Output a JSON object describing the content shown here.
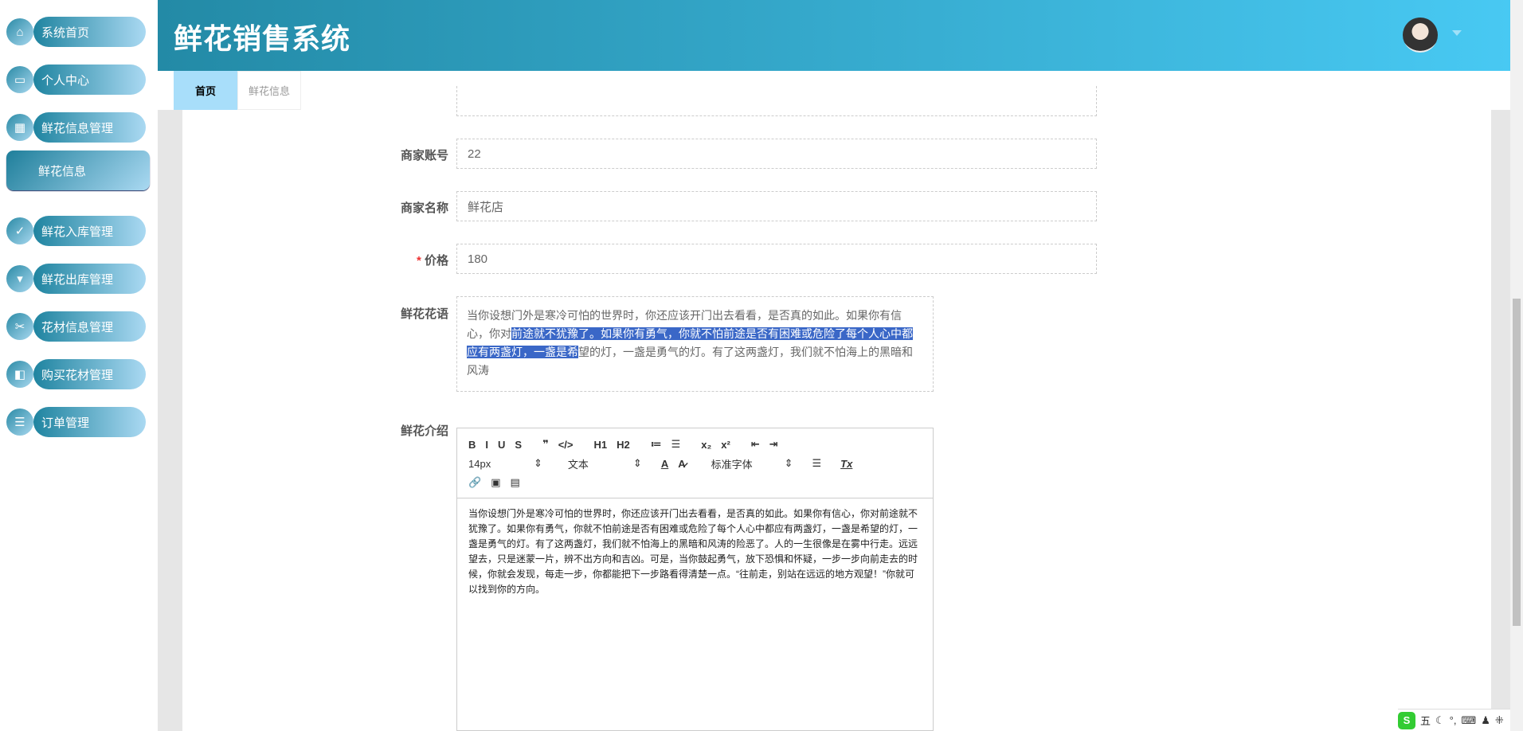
{
  "app": {
    "title": "鲜花销售系统"
  },
  "sidebar": {
    "items": [
      {
        "label": "系统首页",
        "icon": "home-icon"
      },
      {
        "label": "个人中心",
        "icon": "card-icon"
      },
      {
        "label": "鲜花信息管理",
        "icon": "grid-icon"
      },
      {
        "label": "鲜花入库管理",
        "icon": "clipboard-icon"
      },
      {
        "label": "鲜花出库管理",
        "icon": "brush-icon"
      },
      {
        "label": "花材信息管理",
        "icon": "ticket-icon"
      },
      {
        "label": "购买花材管理",
        "icon": "wallet-icon"
      },
      {
        "label": "订单管理",
        "icon": "list-icon"
      }
    ],
    "sub_item": "鲜花信息"
  },
  "tabs": [
    {
      "label": "首页"
    },
    {
      "label": "鲜花信息"
    }
  ],
  "form": {
    "merchant_account": {
      "label": "商家账号",
      "value": "22"
    },
    "merchant_name": {
      "label": "商家名称",
      "value": "鲜花店"
    },
    "price": {
      "required": "*",
      "label": "价格",
      "value": "180"
    },
    "flower_language": {
      "label": "鲜花花语",
      "before": "当你设想门外是寒冷可怕的世界时，你还应该开门出去看看，是否真的如此。如果你有信心，你对",
      "selected": "前途就不犹豫了。如果你有勇气，你就不怕前途是否有困难或危险了每个人心中都应有两盏灯，一盏是希",
      "after": "望的灯，一盏是勇气的灯。有了这两盏灯，我们就不怕海上的黑暗和风涛"
    },
    "intro": {
      "label": "鲜花介绍",
      "content": "当你设想门外是寒冷可怕的世界时，你还应该开门出去看看，是否真的如此。如果你有信心，你对前途就不犹豫了。如果你有勇气，你就不怕前途是否有困难或危险了每个人心中都应有两盏灯，一盏是希望的灯，一盏是勇气的灯。有了这两盏灯，我们就不怕海上的黑暗和风涛的险恶了。人的一生很像是在雾中行走。远远望去，只是迷蒙一片，辨不出方向和吉凶。可是，当你鼓起勇气，放下恐惧和怀疑，一步一步向前走去的时候，你就会发现，每走一步，你都能把下一步路看得清楚一点。“往前走，别站在远远的地方观望！”你就可以找到你的方向。"
    }
  },
  "editor": {
    "row1": [
      "B",
      "I",
      "U",
      "S",
      "❞",
      "</>",
      "H1",
      "H2",
      "≔",
      "☰",
      "x₂",
      "x²",
      "⇤",
      "⇥"
    ],
    "font_size": "14px",
    "heading": "文本",
    "font_family": "标准字体",
    "row2": [
      "A",
      "A̷",
      "☰",
      "Tx"
    ],
    "row3": [
      "🔗",
      "▣",
      "▤"
    ]
  },
  "ime": {
    "mode": "五",
    "icons": [
      "☾",
      "°,",
      "⌨",
      "♟",
      "⁜"
    ]
  }
}
